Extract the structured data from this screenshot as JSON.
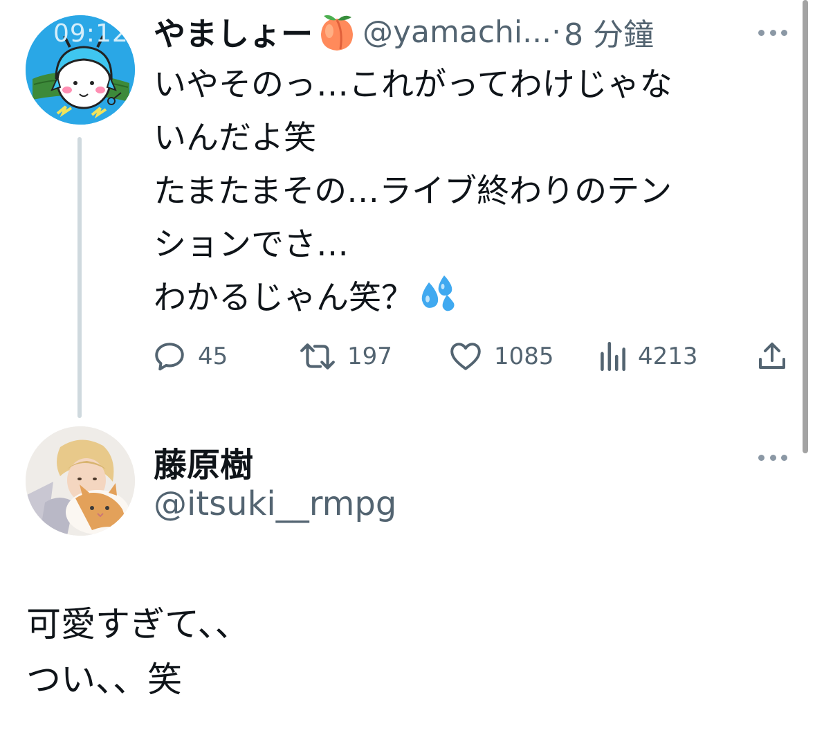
{
  "tweet1": {
    "avatar": {
      "time": "09:12",
      "description_icon": "cartoon-girl-avatar"
    },
    "display_name": "やましょー",
    "name_emoji": "peach-emoji",
    "handle": "@yamachi...",
    "separator": "·",
    "time": "8 分鐘",
    "text_lines": [
      "いやそのっ…これがってわけじゃな",
      "いんだよ笑",
      "たまたまその…ライブ終わりのテン",
      "ションでさ…",
      "わかるじゃん笑？"
    ],
    "text_end_emoji": "sweat-droplets-emoji",
    "stats": {
      "replies": "45",
      "retweets": "197",
      "likes": "1085",
      "views": "4213"
    },
    "colors": {
      "avatar_bg": "#2aa7e6",
      "muted": "#536471"
    }
  },
  "tweet2": {
    "display_name": "藤原樹",
    "handle": "@itsuki__rmpg",
    "text_lines": [
      "可愛すぎて、、",
      "つい、、笑"
    ]
  }
}
